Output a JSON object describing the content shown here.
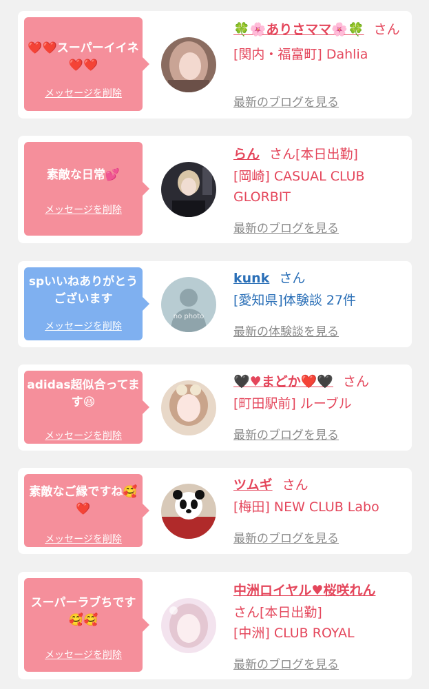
{
  "items": [
    {
      "message": "❤️❤️スーパーイイネ❤️❤️",
      "delete": "メッセージを削除",
      "name": "🍀🌸ありさママ🌸🍀",
      "san": "さん",
      "status": "",
      "shop": "[関内・福富町] Dahlia",
      "blog": "最新のブログを見る",
      "bubble_color": "#f58f9b"
    },
    {
      "message": "素敵な日常💕",
      "delete": "メッセージを削除",
      "name": "らん",
      "san": "さん",
      "status": "[本日出勤]",
      "shop": "[岡崎] CASUAL CLUB GLORBIT",
      "blog": "最新のブログを見る",
      "bubble_color": "#f58f9b"
    },
    {
      "message": "spいいねありがとうございます",
      "delete": "メッセージを削除",
      "name": "kunk",
      "san": "さん",
      "status": "",
      "shop": "[愛知県]体験談 27件",
      "blog": "最新の体験談を見る",
      "avatar_text": "no photo",
      "bubble_color": "#7fb0f0"
    },
    {
      "message": "adidas超似合ってます😆",
      "delete": "メッセージを削除",
      "name": "🖤♥まどか❤️🖤",
      "san": "さん",
      "status": "",
      "shop": "[町田駅前] ルーブル",
      "blog": "最新のブログを見る",
      "bubble_color": "#f58f9b"
    },
    {
      "message": "素敵なご縁ですね🥰❤️",
      "delete": "メッセージを削除",
      "name": "ツムギ",
      "san": "さん",
      "status": "",
      "shop": "[梅田] NEW CLUB Labo",
      "blog": "最新のブログを見る",
      "bubble_color": "#f58f9b"
    },
    {
      "message": "スーパーラブちです🥰🥰",
      "delete": "メッセージを削除",
      "name": "中洲ロイヤル♥桜咲れん",
      "san": "さん",
      "status": "[本日出勤]",
      "shop": "[中洲] CLUB ROYAL",
      "blog": "最新のブログを見る",
      "bubble_color": "#f58f9b"
    }
  ]
}
